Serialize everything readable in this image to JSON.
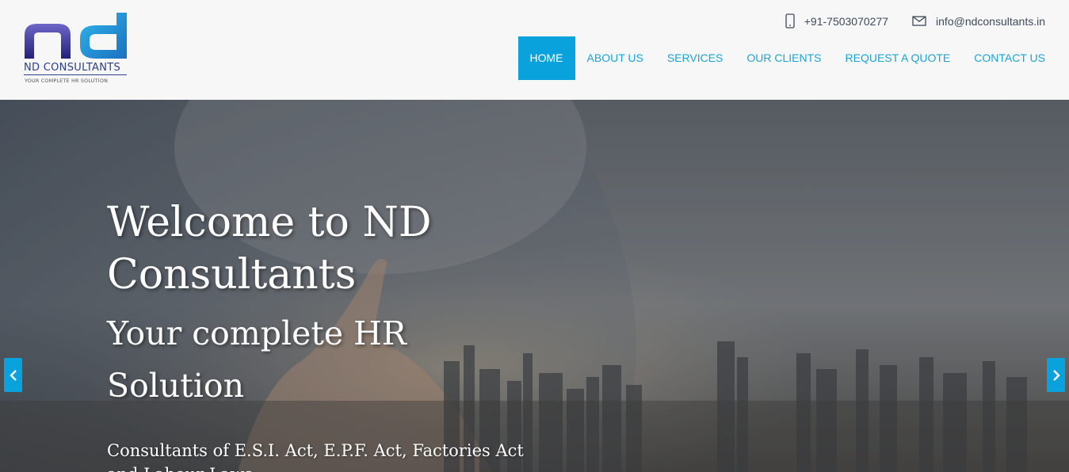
{
  "brand": {
    "name": "ND CONSULTANTS",
    "tagline": "YOUR COMPLETE HR SOLUTION"
  },
  "contact": {
    "phone": "+91-7503070277",
    "email": "info@ndconsultants.in"
  },
  "nav": {
    "items": [
      {
        "label": "HOME",
        "active": true
      },
      {
        "label": "ABOUT US"
      },
      {
        "label": "SERVICES"
      },
      {
        "label": "OUR CLIENTS"
      },
      {
        "label": "REQUEST A QUOTE"
      },
      {
        "label": "CONTACT US"
      }
    ]
  },
  "hero": {
    "title": "Welcome to ND Consultants",
    "subtitle": "Your complete HR Solution",
    "description": "Consultants of E.S.I. Act, E.P.F. Act, Factories Act and Labour Laws"
  },
  "icons": {
    "phone": "phone-icon",
    "email": "envelope-icon",
    "prev": "chevron-left-icon",
    "next": "chevron-right-icon"
  },
  "colors": {
    "accent": "#0aa2dc",
    "nav_text": "#1ba4d7",
    "logo_blue": "#2b3f8c"
  }
}
